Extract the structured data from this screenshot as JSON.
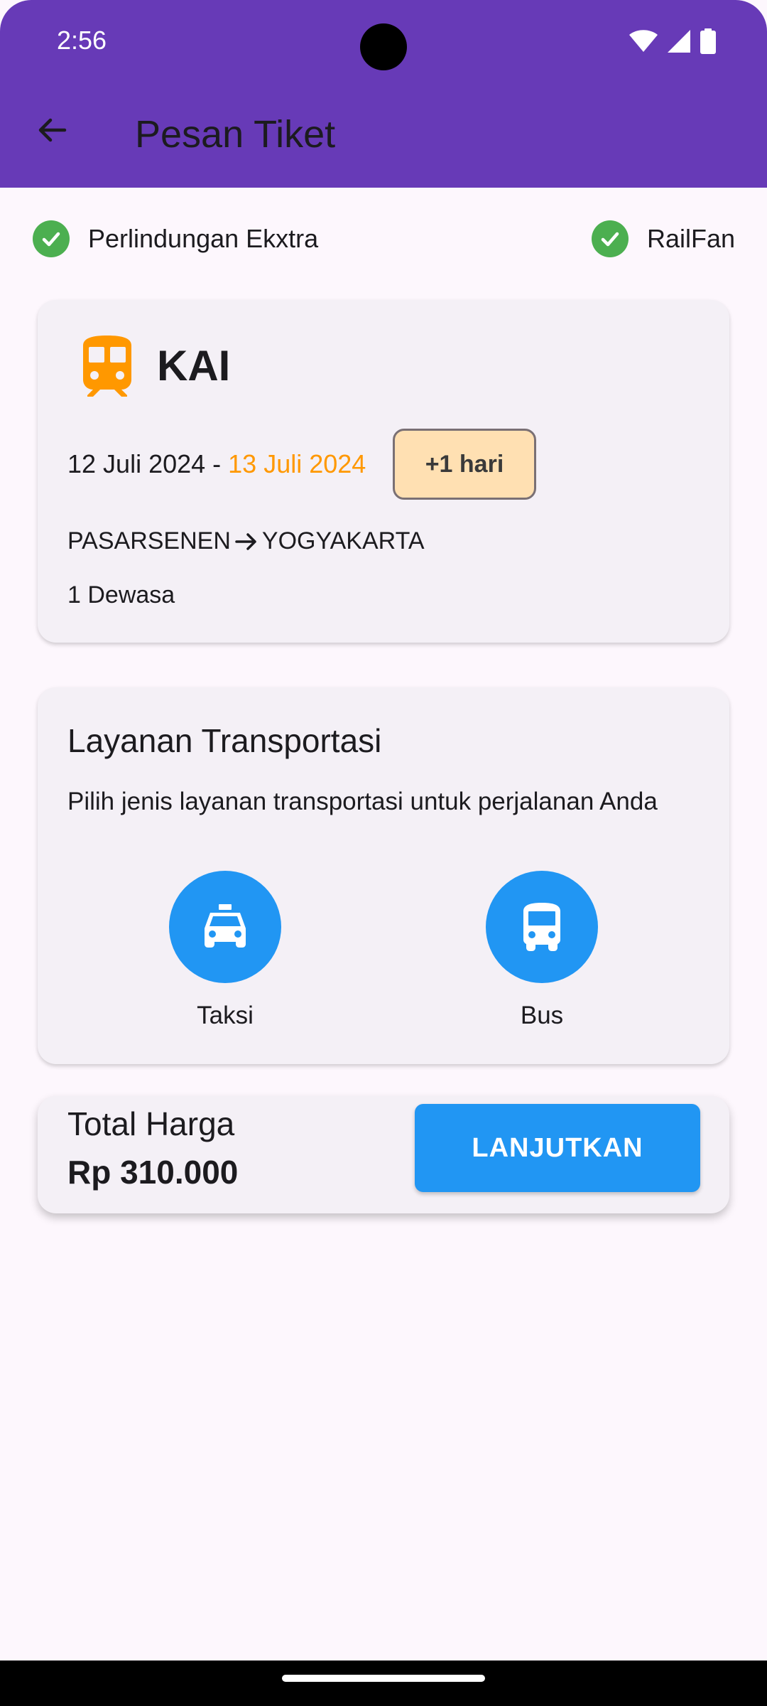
{
  "status_bar": {
    "time": "2:56",
    "icons": [
      "wifi-icon",
      "signal-icon",
      "battery-icon"
    ]
  },
  "app_bar": {
    "back_icon": "arrow-back-icon",
    "title": "Pesan Tiket"
  },
  "features": [
    {
      "label": "Perlindungan Ekxtra",
      "icon": "check-circle-icon"
    },
    {
      "label": "RailFan",
      "icon": "check-circle-icon"
    }
  ],
  "ticket": {
    "icon": "train-icon",
    "carrier": "KAI",
    "depart_date": "12 Juli 2024",
    "separator": " - ",
    "arrive_date": "13 Juli 2024",
    "day_badge": "+1 hari",
    "origin": "PASARSENEN",
    "destination": "YOGYAKARTA",
    "passengers": "1 Dewasa"
  },
  "transport": {
    "title": "Layanan Transportasi",
    "description": "Pilih jenis layanan transportasi untuk perjalanan Anda",
    "services": [
      {
        "label": "Taksi",
        "icon": "taxi-icon"
      },
      {
        "label": "Bus",
        "icon": "bus-icon"
      }
    ]
  },
  "total": {
    "label": "Total Harga",
    "price": "Rp 310.000",
    "button_label": "LANJUTKAN"
  },
  "colors": {
    "app_bar": "#673ab7",
    "background": "#fdf7fd",
    "card": "#f4f0f6",
    "accent_blue": "#2196f3",
    "accent_orange": "#ff9800",
    "check_green": "#4caf50",
    "badge_bg": "#ffe0b2"
  }
}
